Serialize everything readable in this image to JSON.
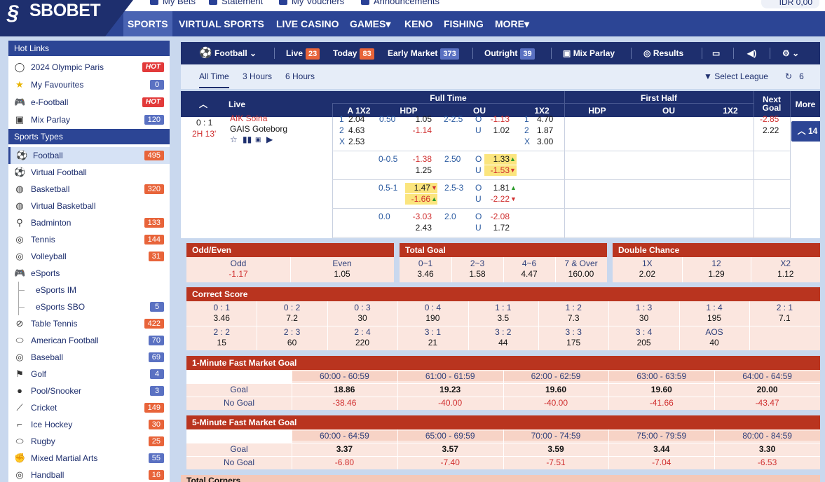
{
  "header": {
    "brand": "SBOBET",
    "links": [
      {
        "label": "My Bets"
      },
      {
        "label": "Statement"
      },
      {
        "label": "My Vouchers"
      },
      {
        "label": "Announcements"
      }
    ],
    "balance": "IDR 0,00",
    "nav": [
      {
        "label": "SPORTS"
      },
      {
        "label": "VIRTUAL SPORTS"
      },
      {
        "label": "LIVE CASINO"
      },
      {
        "label": "GAMES▾"
      },
      {
        "label": "KENO"
      },
      {
        "label": "FISHING"
      },
      {
        "label": "MORE▾"
      }
    ]
  },
  "sidebar": {
    "hot_links_title": "Hot Links",
    "hot_links": [
      {
        "label": "2024 Olympic Paris",
        "badge": "HOT",
        "icon": "olympic-rings-icon"
      },
      {
        "label": "My Favourites",
        "badge": "0",
        "icon": "star-icon"
      },
      {
        "label": "e-Football",
        "badge": "HOT",
        "icon": "gamepad-icon"
      },
      {
        "label": "Mix Parlay",
        "badge": "120",
        "icon": "parlay-icon"
      }
    ],
    "sports_title": "Sports Types",
    "sports": [
      {
        "label": "Football",
        "count": "495",
        "icon": "soccer-ball-icon"
      },
      {
        "label": "Virtual Football",
        "count": "",
        "icon": "virtual-soccer-icon"
      },
      {
        "label": "Basketball",
        "count": "320",
        "icon": "basketball-icon"
      },
      {
        "label": "Virtual Basketball",
        "count": "",
        "icon": "virtual-basketball-icon"
      },
      {
        "label": "Badminton",
        "count": "133",
        "icon": "shuttlecock-icon"
      },
      {
        "label": "Tennis",
        "count": "144",
        "icon": "tennis-ball-icon"
      },
      {
        "label": "Volleyball",
        "count": "31",
        "icon": "volleyball-icon"
      },
      {
        "label": "eSports",
        "count": "",
        "icon": "gamepad-icon"
      },
      {
        "label": "eSports IM",
        "count": ""
      },
      {
        "label": "eSports SBO",
        "count": "5"
      },
      {
        "label": "Table Tennis",
        "count": "422",
        "icon": "paddle-icon"
      },
      {
        "label": "American Football",
        "count": "70",
        "icon": "american-football-icon"
      },
      {
        "label": "Baseball",
        "count": "69",
        "icon": "baseball-icon"
      },
      {
        "label": "Golf",
        "count": "4",
        "icon": "golf-flag-icon"
      },
      {
        "label": "Pool/Snooker",
        "count": "3",
        "icon": "pool-ball-icon"
      },
      {
        "label": "Cricket",
        "count": "149",
        "icon": "cricket-bat-icon"
      },
      {
        "label": "Ice Hockey",
        "count": "30",
        "icon": "hockey-stick-icon"
      },
      {
        "label": "Rugby",
        "count": "25",
        "icon": "rugby-ball-icon"
      },
      {
        "label": "Mixed Martial Arts",
        "count": "55",
        "icon": "glove-icon"
      },
      {
        "label": "Handball",
        "count": "16",
        "icon": "handball-icon"
      }
    ]
  },
  "tabs": {
    "sport": "Football",
    "live": "Live",
    "live_count": "23",
    "today": "Today",
    "today_count": "83",
    "early": "Early Market",
    "early_count": "373",
    "outright": "Outright",
    "outright_count": "39",
    "mix": "Mix Parlay",
    "results": "Results"
  },
  "time_filters": [
    "All Time",
    "3 Hours",
    "6 Hours"
  ],
  "select_league": "Select League",
  "refresh_count": "6",
  "grid": {
    "live": "Live",
    "full_time": "Full Time",
    "first_half": "First Half",
    "next_goal": "Next Goal",
    "more": "More",
    "cols": {
      "a1x2": "A 1X2",
      "hdp": "HDP",
      "ou": "OU",
      "x12": "1X2",
      "hdp2": "HDP",
      "ou2": "OU",
      "x122": "1X2"
    },
    "match": {
      "score": "0 : 1",
      "time": "2H 13'",
      "home": "AIK Solna",
      "away": "GAIS Goteborg"
    },
    "more_count": "14",
    "row0": {
      "a1": "1",
      "a1v": "2.04",
      "a2": "2",
      "a2v": "4.63",
      "ax": "X",
      "axv": "2.53",
      "hdp": "0.50",
      "h1": "1.05",
      "h2": "-1.14",
      "ou": "2-2.5",
      "o1": "-1.13",
      "o2": "1.02",
      "ol1": "O",
      "ol2": "U",
      "x1": "1",
      "x1v": "4.70",
      "x2": "2",
      "x2v": "1.87",
      "xx": "X",
      "xxv": "3.00",
      "ng": "-2.85",
      "ng2": "2.22"
    },
    "row1": {
      "hdp": "0-0.5",
      "h1": "-1.38",
      "h2": "1.25",
      "ou": "2.50",
      "o1": "1.33",
      "o2": "-1.53",
      "ol1": "O",
      "ol2": "U"
    },
    "row2": {
      "hdp": "0.5-1",
      "h1": "1.47",
      "h2": "-1.66",
      "ou": "2.5-3",
      "o1": "1.81",
      "o2": "-2.22",
      "ol1": "O",
      "ol2": "U"
    },
    "row3": {
      "hdp": "0.0",
      "h1": "-3.03",
      "h2": "2.43",
      "ou": "2.0",
      "o1": "-2.08",
      "o2": "1.72",
      "ol1": "O",
      "ol2": "U"
    }
  },
  "odd_even": {
    "title": "Odd/Even",
    "items": [
      {
        "k": "Odd",
        "v": "-1.17"
      },
      {
        "k": "Even",
        "v": "1.05"
      }
    ]
  },
  "total_goal": {
    "title": "Total Goal",
    "items": [
      {
        "k": "0~1",
        "v": "3.46"
      },
      {
        "k": "2~3",
        "v": "1.58"
      },
      {
        "k": "4~6",
        "v": "4.47"
      },
      {
        "k": "7 & Over",
        "v": "160.00"
      }
    ]
  },
  "double_chance": {
    "title": "Double Chance",
    "items": [
      {
        "k": "1X",
        "v": "2.02"
      },
      {
        "k": "12",
        "v": "1.29"
      },
      {
        "k": "X2",
        "v": "1.12"
      }
    ]
  },
  "correct_score": {
    "title": "Correct Score",
    "rows": [
      [
        {
          "k": "0 : 1",
          "v": "3.46"
        },
        {
          "k": "0 : 2",
          "v": "7.2"
        },
        {
          "k": "0 : 3",
          "v": "30"
        },
        {
          "k": "0 : 4",
          "v": "190"
        },
        {
          "k": "1 : 1",
          "v": "3.5"
        },
        {
          "k": "1 : 2",
          "v": "7.3"
        },
        {
          "k": "1 : 3",
          "v": "30"
        },
        {
          "k": "1 : 4",
          "v": "195"
        },
        {
          "k": "2 : 1",
          "v": "7.1"
        }
      ],
      [
        {
          "k": "2 : 2",
          "v": "15"
        },
        {
          "k": "2 : 3",
          "v": "60"
        },
        {
          "k": "2 : 4",
          "v": "220"
        },
        {
          "k": "3 : 1",
          "v": "21"
        },
        {
          "k": "3 : 2",
          "v": "44"
        },
        {
          "k": "3 : 3",
          "v": "175"
        },
        {
          "k": "3 : 4",
          "v": "205"
        },
        {
          "k": "AOS",
          "v": "40"
        },
        {
          "k": "",
          "v": ""
        }
      ]
    ]
  },
  "fast1": {
    "title": "1-Minute Fast Market Goal",
    "goal_label": "Goal",
    "nogoal_label": "No Goal",
    "periods": [
      "60:00 - 60:59",
      "61:00 - 61:59",
      "62:00 - 62:59",
      "63:00 - 63:59",
      "64:00 - 64:59"
    ],
    "goal": [
      "18.86",
      "19.23",
      "19.60",
      "19.60",
      "20.00"
    ],
    "nogoal": [
      "-38.46",
      "-40.00",
      "-40.00",
      "-41.66",
      "-43.47"
    ]
  },
  "fast5": {
    "title": "5-Minute Fast Market Goal",
    "goal_label": "Goal",
    "nogoal_label": "No Goal",
    "periods": [
      "60:00 - 64:59",
      "65:00 - 69:59",
      "70:00 - 74:59",
      "75:00 - 79:59",
      "80:00 - 84:59"
    ],
    "goal": [
      "3.37",
      "3.57",
      "3.59",
      "3.44",
      "3.30"
    ],
    "nogoal": [
      "-6.80",
      "-7.40",
      "-7.51",
      "-7.04",
      "-6.53"
    ]
  },
  "total_corners": {
    "title": "Total Corners"
  },
  "colors": {
    "navy": "#1e2f6e",
    "accent": "#2c4595",
    "hot": "#e23a3a",
    "badge_orange": "#e8643a",
    "badge_blue": "#5a71c2",
    "panel_red": "#b9341f",
    "odds_highlight": "#fbe57e"
  }
}
